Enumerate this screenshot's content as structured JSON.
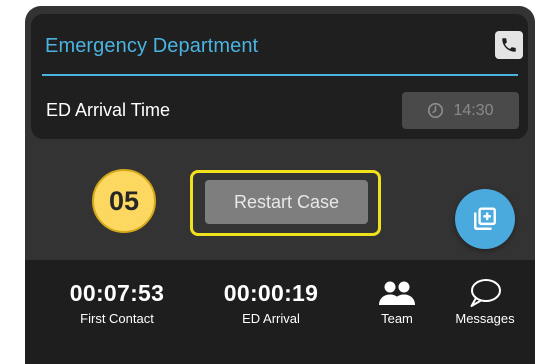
{
  "header": {
    "title": "Emergency Department",
    "phone_icon": "phone-icon"
  },
  "arrival": {
    "label": "ED Arrival Time",
    "time": "14:30",
    "clock_icon": "clock-icon"
  },
  "case": {
    "number": "05",
    "restart_label": "Restart Case"
  },
  "fab": {
    "icon": "add-stack-icon"
  },
  "timers": [
    {
      "value": "00:07:53",
      "label": "First Contact"
    },
    {
      "value": "00:00:19",
      "label": "ED Arrival"
    }
  ],
  "nav": {
    "team_label": "Team",
    "team_icon": "team-icon",
    "messages_label": "Messages",
    "messages_icon": "chat-bubble-icon"
  },
  "colors": {
    "accent": "#4ab3df",
    "badge": "#fcd860",
    "highlight": "#f0e11c",
    "panel": "#333333",
    "bar": "#1e1e1e"
  }
}
